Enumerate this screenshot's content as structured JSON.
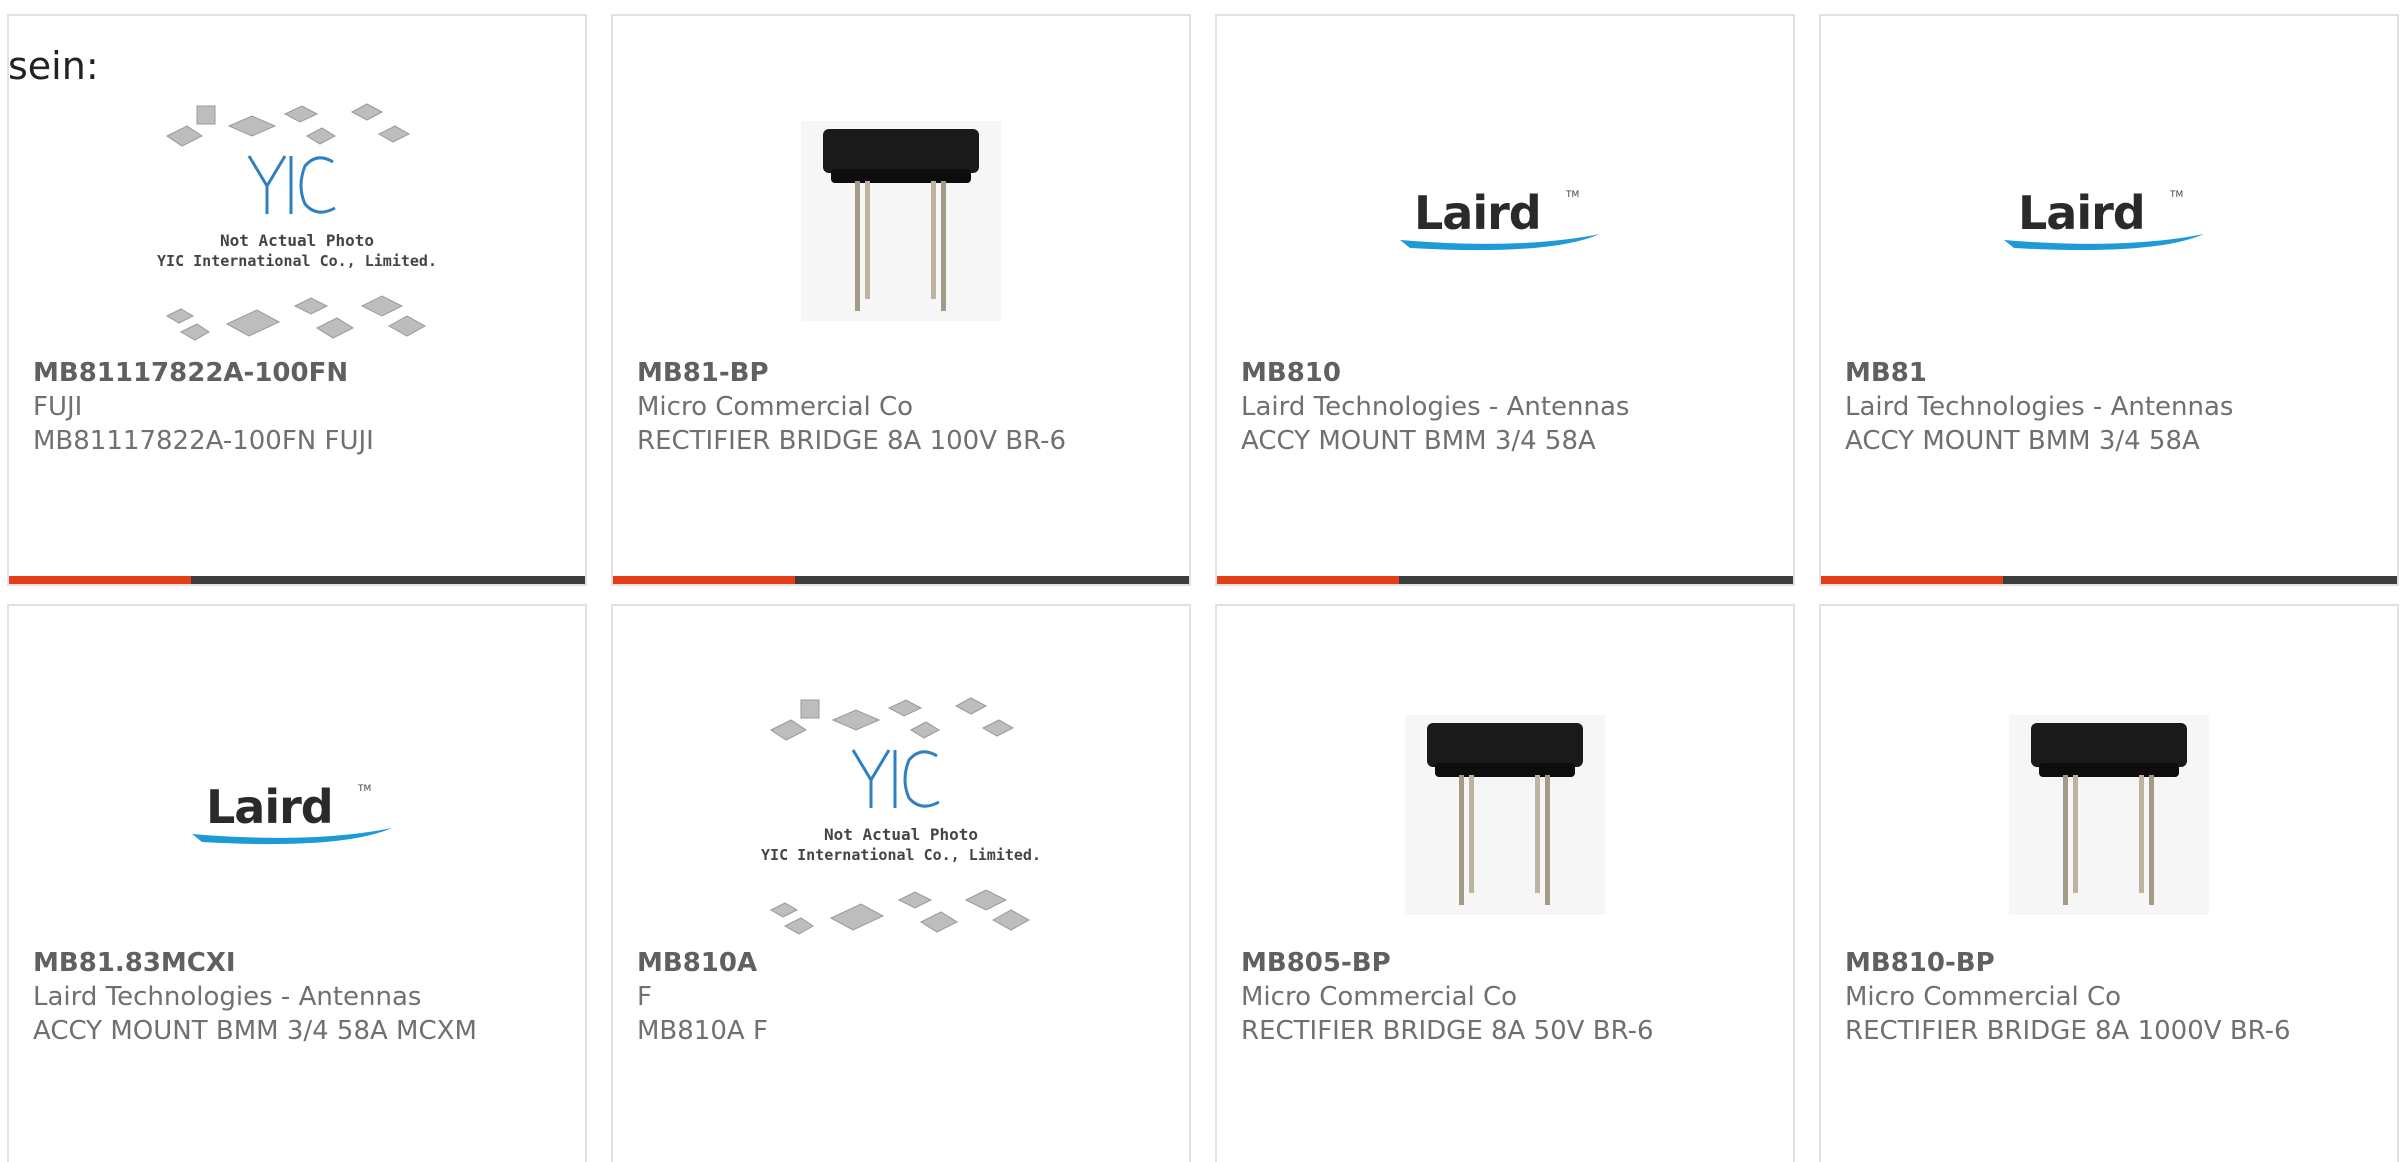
{
  "heading": "sein:",
  "placeholder": {
    "line1": "Not Actual Photo",
    "line2": "YIC International Co., Limited."
  },
  "brand": {
    "accent": "#e43e17",
    "bar": "#3d3d3d",
    "laird_logo_text": "Laird"
  },
  "products": [
    {
      "part": "MB81117822A-100FN",
      "manufacturer": "FUJI",
      "description": "MB81117822A-100FN FUJI",
      "image": "yic-placeholder-icon"
    },
    {
      "part": "MB81-BP",
      "manufacturer": "Micro Commercial Co",
      "description": "RECTIFIER BRIDGE 8A 100V BR-6",
      "image": "bridge-rectifier-icon"
    },
    {
      "part": "MB810",
      "manufacturer": "Laird Technologies - Antennas",
      "description": "ACCY MOUNT BMM 3/4 58A",
      "image": "laird-logo-icon"
    },
    {
      "part": "MB81",
      "manufacturer": "Laird Technologies - Antennas",
      "description": "ACCY MOUNT BMM 3/4 58A",
      "image": "laird-logo-icon"
    },
    {
      "part": "MB81.83MCXI",
      "manufacturer": "Laird Technologies - Antennas",
      "description": "ACCY MOUNT BMM 3/4 58A MCXM",
      "image": "laird-logo-icon"
    },
    {
      "part": "MB810A",
      "manufacturer": "F",
      "description": "MB810A F",
      "image": "yic-placeholder-icon"
    },
    {
      "part": "MB805-BP",
      "manufacturer": "Micro Commercial Co",
      "description": "RECTIFIER BRIDGE 8A 50V BR-6",
      "image": "bridge-rectifier-icon"
    },
    {
      "part": "MB810-BP",
      "manufacturer": "Micro Commercial Co",
      "description": "RECTIFIER BRIDGE 8A 1000V BR-6",
      "image": "bridge-rectifier-icon"
    }
  ]
}
